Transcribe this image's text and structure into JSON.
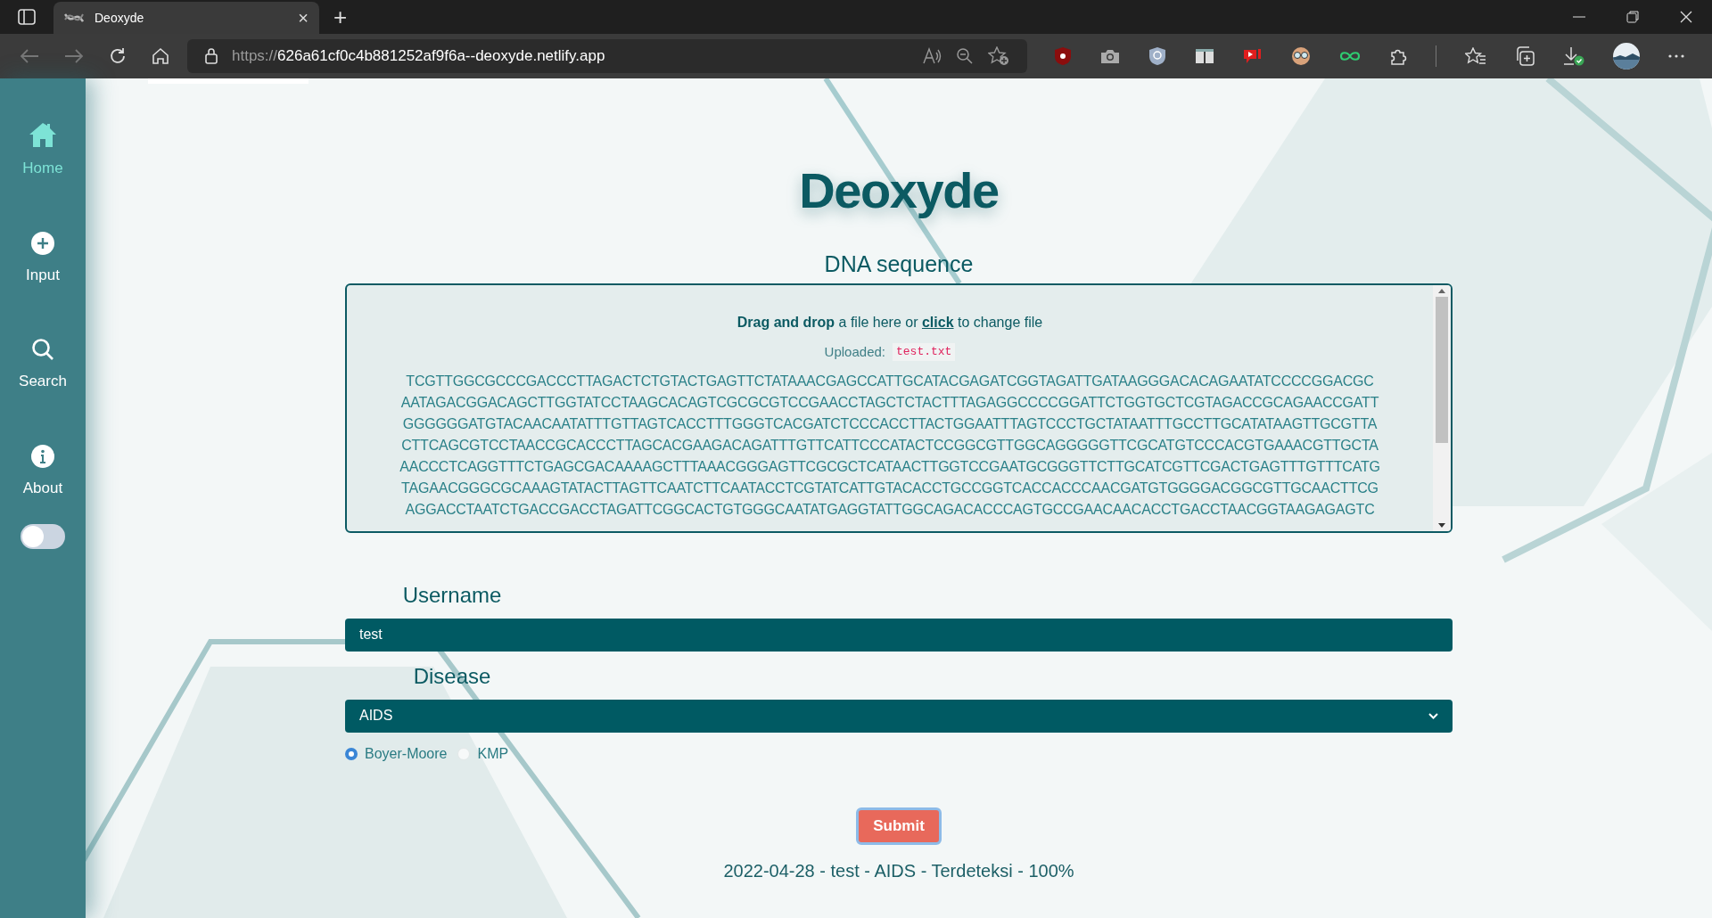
{
  "browser": {
    "tab_title": "Deoxyde",
    "tab_close": "×",
    "new_tab": "+",
    "url_scheme": "https://",
    "url_host": "626a61cf0c4b881252af9f6a--deoxyde.netlify.app"
  },
  "sidebar": {
    "items": [
      {
        "label": "Home",
        "selected": true
      },
      {
        "label": "Input",
        "selected": false
      },
      {
        "label": "Search",
        "selected": false
      },
      {
        "label": "About",
        "selected": false
      }
    ],
    "dark_mode_toggle": {
      "on": false
    }
  },
  "page": {
    "title": "Deoxyde",
    "dna": {
      "label": "DNA sequence",
      "hint_bold": "Drag and drop",
      "hint_middle": "a file here or",
      "hint_link": "click",
      "hint_end": "to change file",
      "uploaded_label": "Uploaded:",
      "uploaded_file": "test.txt",
      "lines": [
        "TCGTTGGCGCCCGACCCTTAGACTCTGTACTGAGTTCTATAAACGAGCCATTGCATACGAGATCGGTAGATTGATAAGGGACACAGAATATCCCCGGACGC",
        "AATAGACGGACAGCTTGGTATCCTAAGCACAGTCGCGCGTCCGAACCTAGCTCTACTTTAGAGGCCCCGGATTCTGGTGCTCGTAGACCGCAGAACCGATT",
        "GGGGGGATGTACAACAATATTTGTTAGTCACCTTTGGGTCACGATCTCCCACCTTACTGGAATTTAGTCCCTGCTATAATTTGCCTTGCATATAAGTTGCGTTA",
        "CTTCAGCGTCCTAACCGCACCCTTAGCACGAAGACAGATTTGTTCATTCCCATACTCCGGCGTTGGCAGGGGGTTCGCATGTCCCACGTGAAACGTTGCTA",
        "AACCCTCAGGTTTCTGAGCGACAAAAGCTTTAAACGGGAGTTCGCGCTCATAACTTGGTCCGAATGCGGGTTCTTGCATCGTTCGACTGAGTTTGTTTCATG",
        "TAGAACGGGCGCAAAGTATACTTAGTTCAATCTTCAATACCTCGTATCATTGTACACCTGCCGGTCACCACCCAACGATGTGGGGACGGCGTTGCAACTTCG",
        "AGGACCTAATCTGACCGACCTAGATTCGGCACTGTGGGCAATATGAGGTATTGGCAGACACCCAGTGCCGAACAACACCTGACCTAACGGTAAGAGAGTC"
      ]
    },
    "username": {
      "label": "Username",
      "value": "test"
    },
    "disease": {
      "label": "Disease",
      "value": "AIDS"
    },
    "algorithms": [
      {
        "label": "Boyer-Moore",
        "selected": true
      },
      {
        "label": "KMP",
        "selected": false
      }
    ],
    "submit": "Submit",
    "result": "2022-04-28 - test - AIDS - Terdeteksi - 100%"
  }
}
